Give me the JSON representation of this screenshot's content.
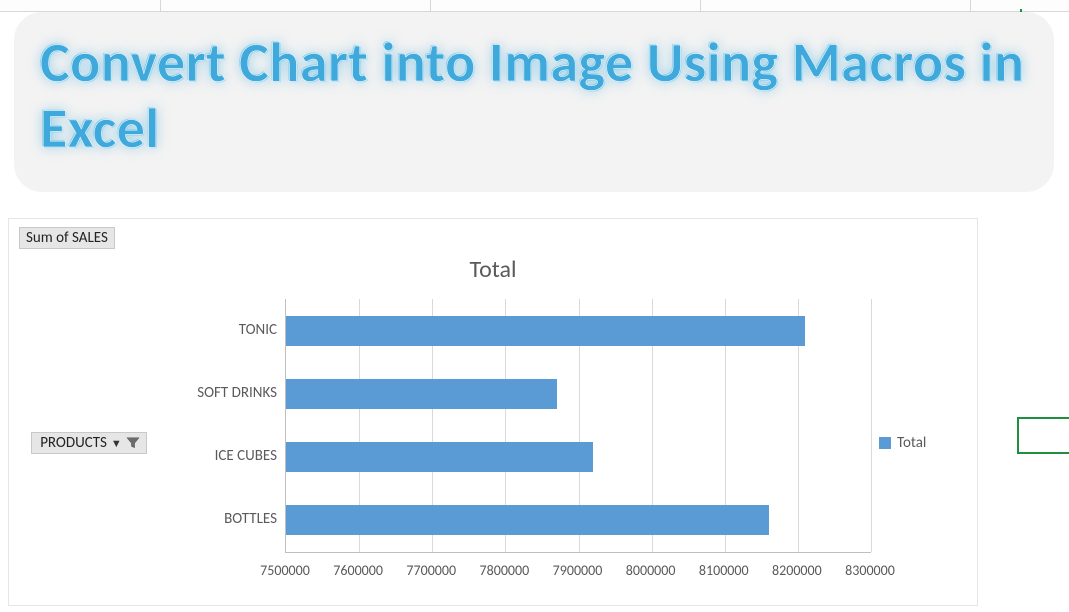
{
  "banner": {
    "title": "Convert Chart into Image Using Macros in Excel"
  },
  "pivot": {
    "field_title": "Sum of SALES",
    "axis_field": "PRODUCTS"
  },
  "legend": {
    "series_label": "Total"
  },
  "chart_data": {
    "type": "bar",
    "title": "Total",
    "xlabel": "",
    "ylabel": "",
    "orientation": "horizontal",
    "categories": [
      "TONIC",
      "SOFT DRINKS",
      "ICE CUBES",
      "BOTTLES"
    ],
    "series": [
      {
        "name": "Total",
        "values": [
          8210000,
          7870000,
          7920000,
          8160000
        ]
      }
    ],
    "xlim": [
      7500000,
      8300000
    ],
    "x_ticks": [
      7500000,
      7600000,
      7700000,
      7800000,
      7900000,
      8000000,
      8100000,
      8200000,
      8300000
    ],
    "grid": {
      "x": true,
      "y": false
    },
    "legend_position": "right",
    "bar_color": "#5b9bd5"
  }
}
